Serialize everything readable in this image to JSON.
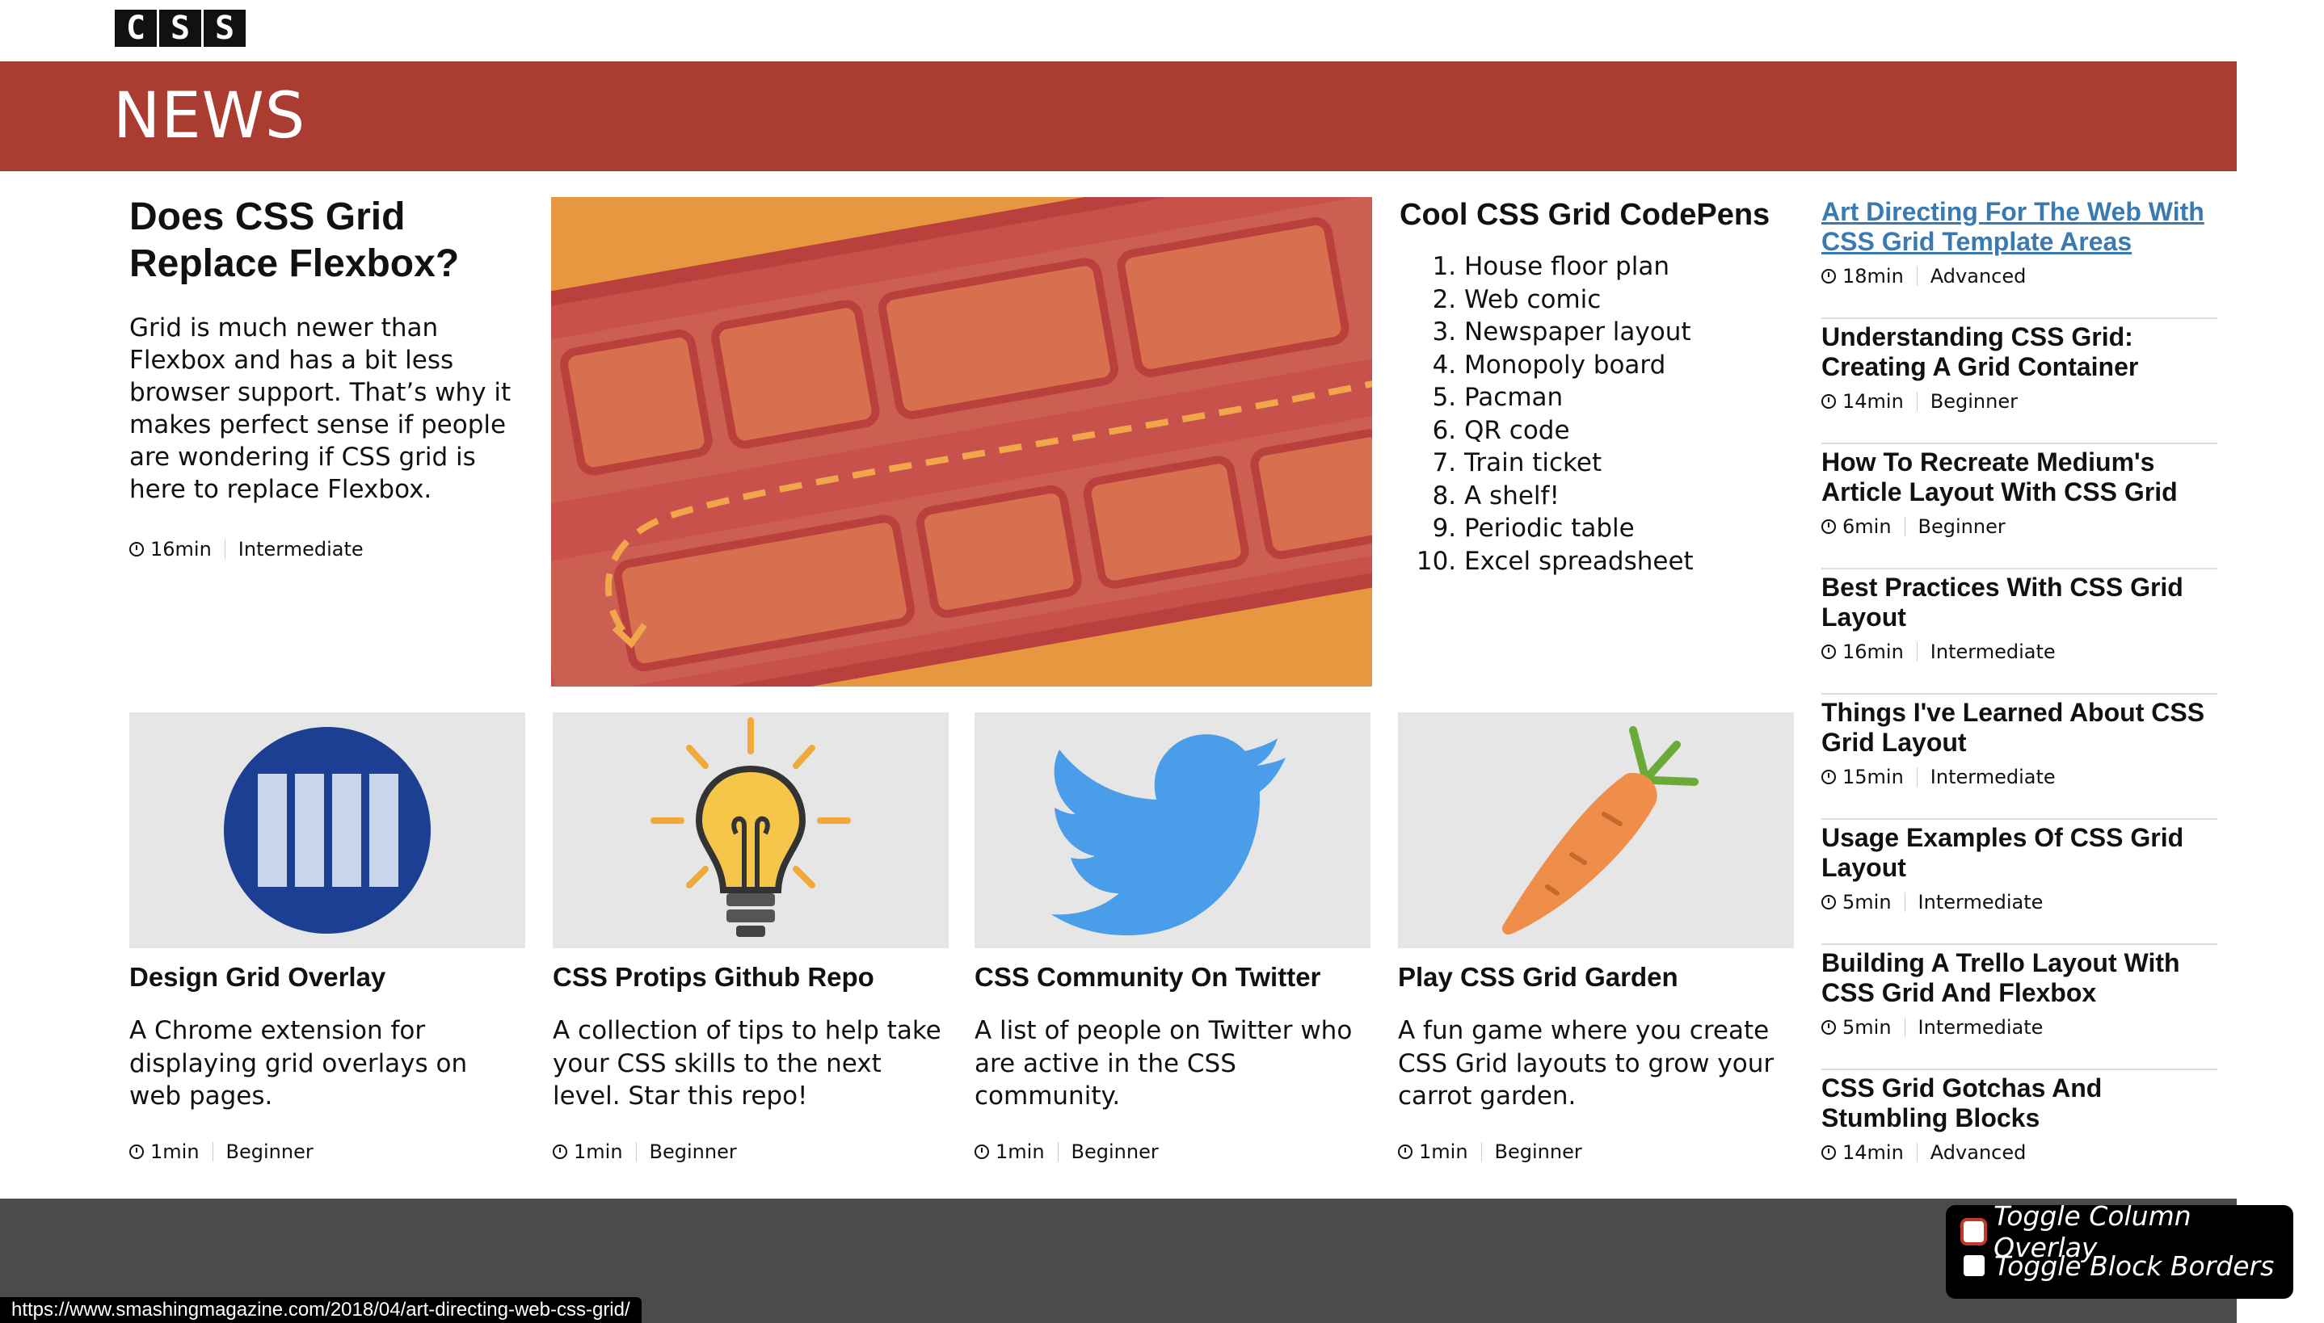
{
  "logo": {
    "letters": [
      "C",
      "S",
      "S"
    ]
  },
  "banner": {
    "title": "NEWS",
    "color": "#ab3c32"
  },
  "feature": {
    "title": "Does CSS Grid Replace Flexbox?",
    "body": "Grid is much newer than Flexbox and has a bit less browser support. That’s why it makes perfect sense if people are wondering if CSS grid is here to replace Flexbox.",
    "time": "16min",
    "level": "Intermediate"
  },
  "codepens": {
    "title": "Cool CSS Grid CodePens",
    "items": [
      "House floor plan",
      "Web comic",
      "Newspaper layout",
      "Monopoly board",
      "Pacman",
      "QR code",
      "Train ticket",
      "A shelf!",
      "Periodic table",
      "Excel spreadsheet"
    ]
  },
  "sidebar": {
    "items": [
      {
        "title": "Art Directing For The Web With CSS Grid Template Areas",
        "time": "18min",
        "level": "Advanced"
      },
      {
        "title": "Understanding CSS Grid: Creating A Grid Container",
        "time": "14min",
        "level": "Beginner"
      },
      {
        "title": "How To Recreate Medium's Article Layout With CSS Grid",
        "time": "6min",
        "level": "Beginner"
      },
      {
        "title": "Best Practices With CSS Grid Layout",
        "time": "16min",
        "level": "Intermediate"
      },
      {
        "title": "Things I've Learned About CSS Grid Layout",
        "time": "15min",
        "level": "Intermediate"
      },
      {
        "title": "Usage Examples Of CSS Grid Layout",
        "time": "5min",
        "level": "Intermediate"
      },
      {
        "title": "Building A Trello Layout With CSS Grid And Flexbox",
        "time": "5min",
        "level": "Intermediate"
      },
      {
        "title": "CSS Grid Gotchas And Stumbling Blocks",
        "time": "14min",
        "level": "Advanced"
      }
    ]
  },
  "cards": [
    {
      "icon": "grid-overlay-icon",
      "title": "Design Grid Overlay",
      "body": "A Chrome extension for displaying grid overlays on web pages.",
      "time": "1min",
      "level": "Beginner"
    },
    {
      "icon": "lightbulb-icon",
      "title": "CSS Protips Github Repo",
      "body": "A collection of tips to help take your CSS skills to the next level. Star this repo!",
      "time": "1min",
      "level": "Beginner"
    },
    {
      "icon": "twitter-bird-icon",
      "title": "CSS Community On Twitter",
      "body": "A list of people on Twitter who are active in the CSS community.",
      "time": "1min",
      "level": "Beginner"
    },
    {
      "icon": "carrot-icon",
      "title": "Play CSS Grid Garden",
      "body": "A fun game where you create CSS Grid layouts to grow your carrot garden.",
      "time": "1min",
      "level": "Beginner"
    }
  ],
  "overlay_controls": {
    "toggle_column": "Toggle Column Overlay",
    "toggle_borders": "Toggle Block Borders"
  },
  "status_bar": {
    "url": "https://www.smashingmagazine.com/2018/04/art-directing-web-css-grid/"
  }
}
